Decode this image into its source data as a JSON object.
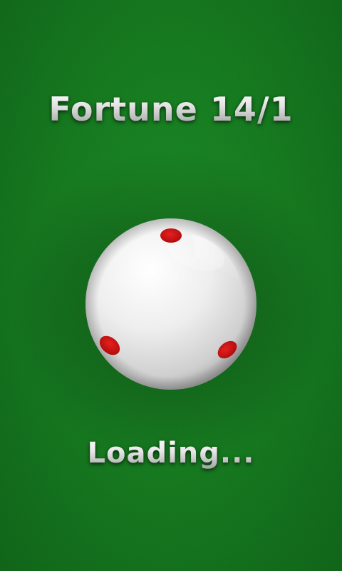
{
  "screen": {
    "title": "Fortune 14/1",
    "status_text": "Loading..."
  },
  "ball": {
    "icon": "cue-ball-icon",
    "base_color": "#ececec",
    "dot_color": "#d41414",
    "dot_count": 3
  },
  "theme": {
    "felt_color": "#157a1f"
  }
}
